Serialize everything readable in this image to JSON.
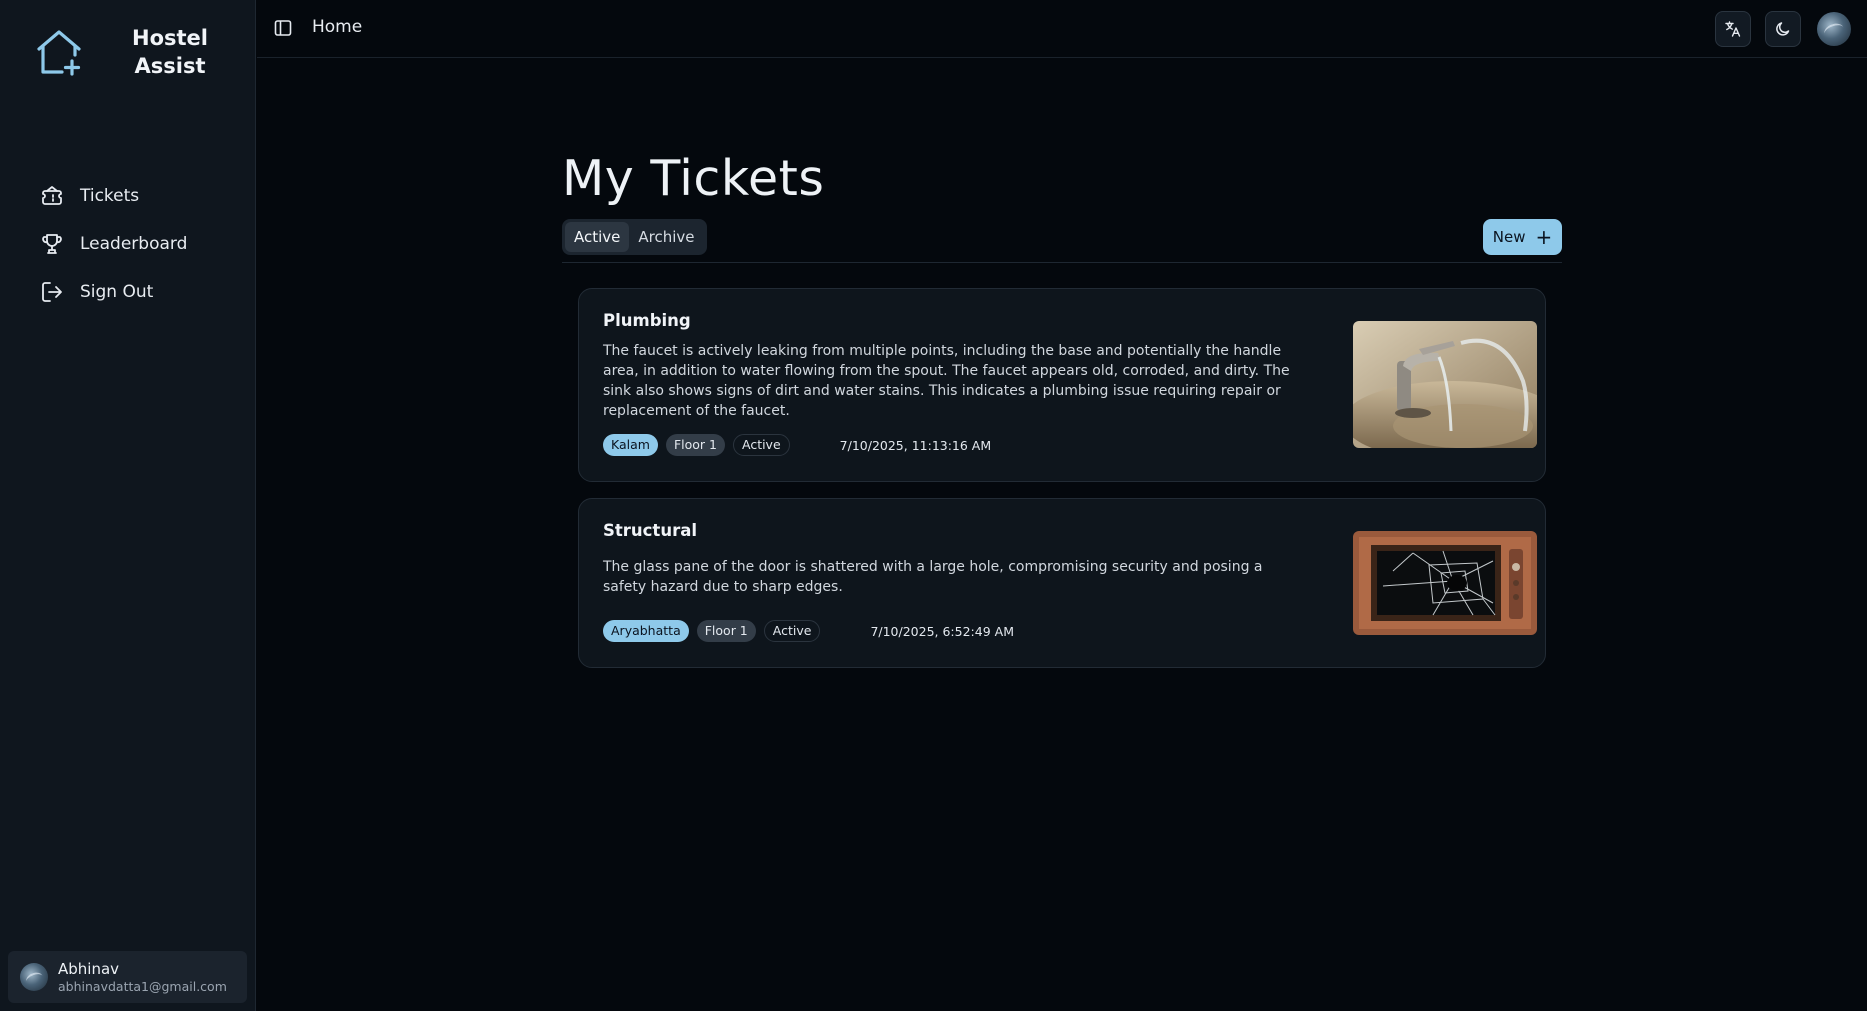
{
  "app": {
    "name": "Hostel Assist",
    "logo_icon": "home-plus-icon",
    "accent_color": "#8ec9ea"
  },
  "sidebar": {
    "items": [
      {
        "label": "Tickets",
        "icon": "ticket-icon"
      },
      {
        "label": "Leaderboard",
        "icon": "trophy-icon"
      },
      {
        "label": "Sign Out",
        "icon": "sign-out-icon"
      }
    ],
    "user": {
      "name": "Abhinav",
      "email": "abhinavdatta1@gmail.com"
    }
  },
  "header": {
    "breadcrumb": "Home",
    "icons": [
      "sidebar-toggle-icon",
      "translate-icon",
      "moon-icon",
      "avatar"
    ]
  },
  "main": {
    "title": "My Tickets",
    "tabs": [
      {
        "label": "Active",
        "selected": true
      },
      {
        "label": "Archive",
        "selected": false
      }
    ],
    "new_button": "New",
    "tickets": [
      {
        "title": "Plumbing",
        "description": "The faucet is actively leaking from multiple points, including the base and potentially the handle area, in addition to water flowing from the spout. The faucet appears old, corroded, and dirty. The sink also shows signs of dirt and water stains. This indicates a plumbing issue requiring repair or replacement of the faucet.",
        "hostel": "Kalam",
        "floor": "Floor 1",
        "status": "Active",
        "date": "7/10/2025, 11:13:16 AM",
        "image": "leaking-faucet"
      },
      {
        "title": "Structural",
        "description": "The glass pane of the door is shattered with a large hole, compromising security and posing a safety hazard due to sharp edges.",
        "hostel": "Aryabhatta",
        "floor": "Floor 1",
        "status": "Active",
        "date": "7/10/2025, 6:52:49 AM",
        "image": "broken-door-glass"
      }
    ]
  }
}
